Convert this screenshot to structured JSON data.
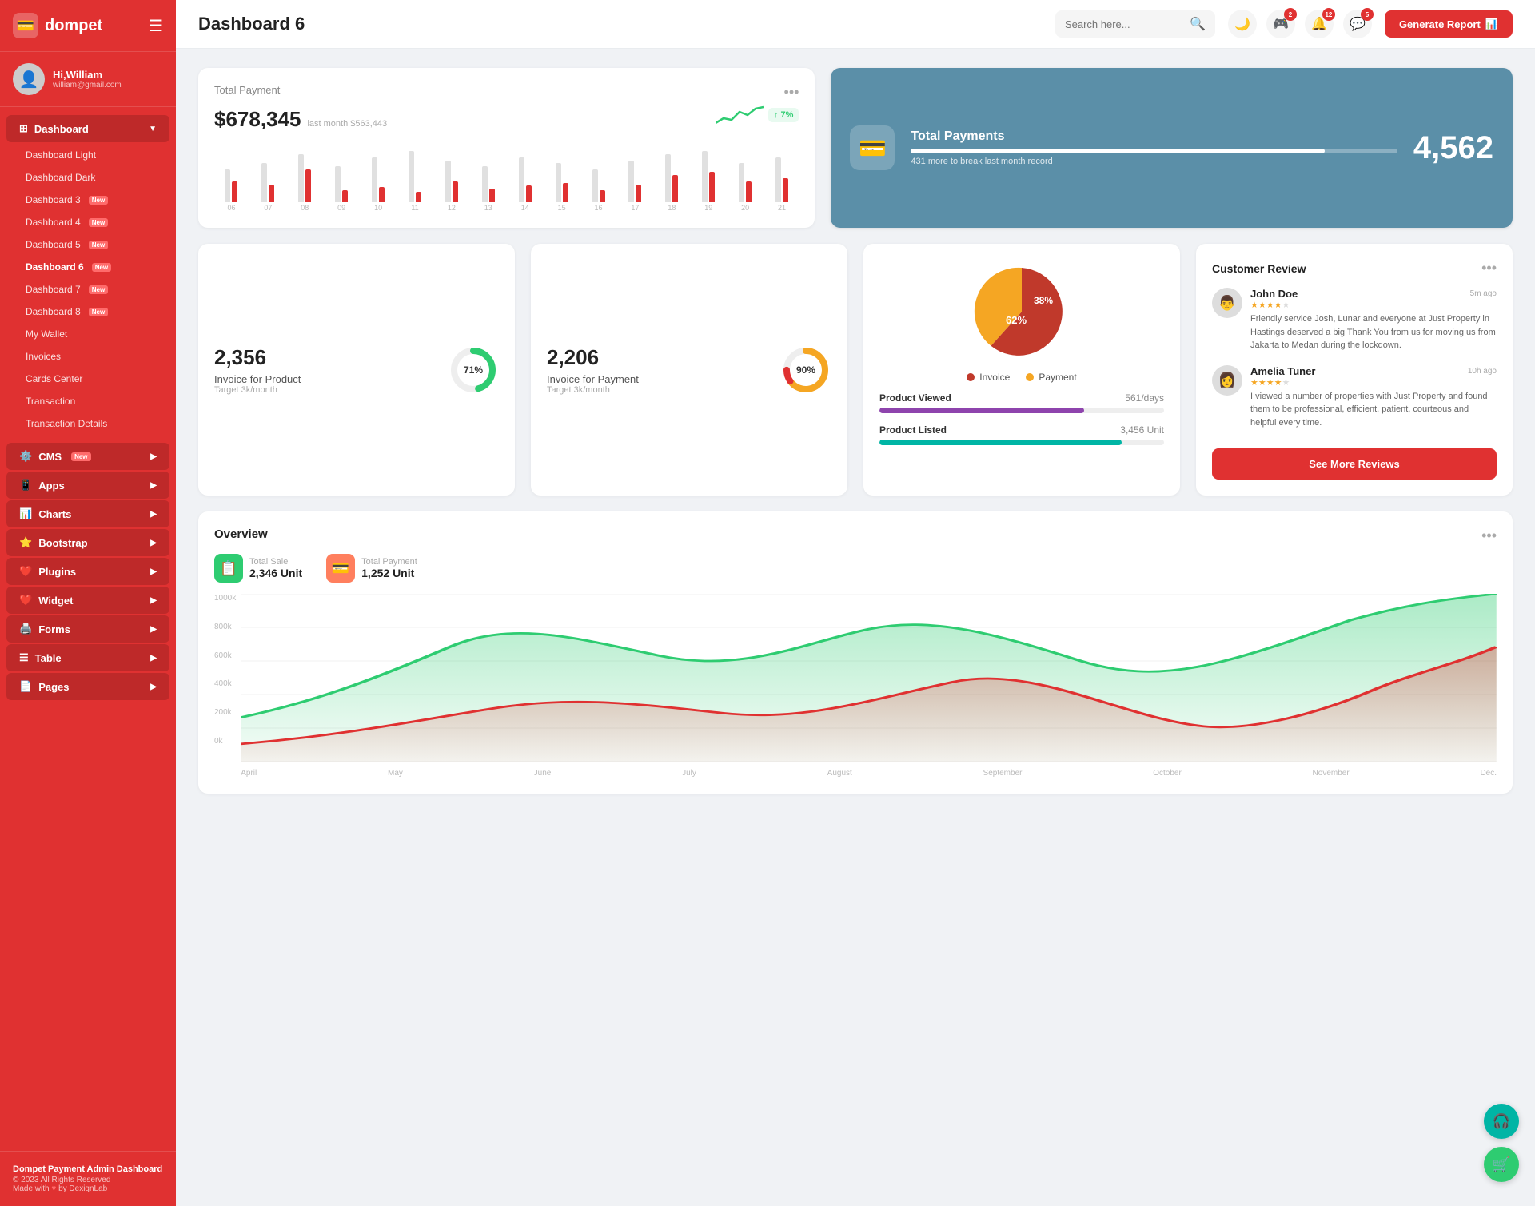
{
  "app": {
    "name": "dompet",
    "logo_symbol": "💳"
  },
  "user": {
    "greeting": "Hi,",
    "name": "William",
    "email": "william@gmail.com",
    "avatar_symbol": "👤"
  },
  "topbar": {
    "page_title": "Dashboard 6",
    "search_placeholder": "Search here...",
    "generate_report_label": "Generate Report",
    "icons": {
      "moon": "🌙",
      "game": "🎮",
      "bell": "🔔",
      "chat": "💬"
    },
    "badges": {
      "game": "2",
      "bell": "12",
      "chat": "5"
    }
  },
  "sidebar": {
    "dashboard_label": "Dashboard",
    "items": [
      {
        "id": "dashboard-light",
        "label": "Dashboard Light",
        "badge": ""
      },
      {
        "id": "dashboard-dark",
        "label": "Dashboard Dark",
        "badge": ""
      },
      {
        "id": "dashboard-3",
        "label": "Dashboard 3",
        "badge": "New"
      },
      {
        "id": "dashboard-4",
        "label": "Dashboard 4",
        "badge": "New"
      },
      {
        "id": "dashboard-5",
        "label": "Dashboard 5",
        "badge": "New"
      },
      {
        "id": "dashboard-6",
        "label": "Dashboard 6",
        "badge": "New",
        "active": true
      },
      {
        "id": "dashboard-7",
        "label": "Dashboard 7",
        "badge": "New"
      },
      {
        "id": "dashboard-8",
        "label": "Dashboard 8",
        "badge": "New"
      },
      {
        "id": "my-wallet",
        "label": "My Wallet",
        "badge": ""
      },
      {
        "id": "invoices",
        "label": "Invoices",
        "badge": ""
      },
      {
        "id": "cards-center",
        "label": "Cards Center",
        "badge": ""
      },
      {
        "id": "transaction",
        "label": "Transaction",
        "badge": ""
      },
      {
        "id": "transaction-details",
        "label": "Transaction Details",
        "badge": ""
      }
    ],
    "nav_sections": [
      {
        "id": "cms",
        "label": "CMS",
        "badge": "New",
        "icon": "⚙️"
      },
      {
        "id": "apps",
        "label": "Apps",
        "badge": "",
        "icon": "📱"
      },
      {
        "id": "charts",
        "label": "Charts",
        "badge": "",
        "icon": "📊"
      },
      {
        "id": "bootstrap",
        "label": "Bootstrap",
        "badge": "",
        "icon": "⭐"
      },
      {
        "id": "plugins",
        "label": "Plugins",
        "badge": "",
        "icon": "❤️"
      },
      {
        "id": "widget",
        "label": "Widget",
        "badge": "",
        "icon": "❤️"
      },
      {
        "id": "forms",
        "label": "Forms",
        "badge": "",
        "icon": "🖨️"
      },
      {
        "id": "table",
        "label": "Table",
        "badge": "",
        "icon": "☰"
      },
      {
        "id": "pages",
        "label": "Pages",
        "badge": "",
        "icon": "📄"
      }
    ],
    "footer": {
      "title": "Dompet Payment Admin Dashboard",
      "copyright": "© 2023 All Rights Reserved",
      "made_with": "Made with",
      "by": "by DexignLab"
    }
  },
  "total_payment": {
    "title": "Total Payment",
    "amount": "$678,345",
    "last_month_label": "last month $563,443",
    "trend_percent": "7%",
    "trend_arrow": "↑",
    "bars": [
      {
        "label": "06",
        "gray": 55,
        "red": 35
      },
      {
        "label": "07",
        "gray": 65,
        "red": 30
      },
      {
        "label": "08",
        "gray": 80,
        "red": 55
      },
      {
        "label": "09",
        "gray": 60,
        "red": 20
      },
      {
        "label": "10",
        "gray": 75,
        "red": 25
      },
      {
        "label": "11",
        "gray": 85,
        "red": 18
      },
      {
        "label": "12",
        "gray": 70,
        "red": 35
      },
      {
        "label": "13",
        "gray": 60,
        "red": 22
      },
      {
        "label": "14",
        "gray": 75,
        "red": 28
      },
      {
        "label": "15",
        "gray": 65,
        "red": 32
      },
      {
        "label": "16",
        "gray": 55,
        "red": 20
      },
      {
        "label": "17",
        "gray": 70,
        "red": 30
      },
      {
        "label": "18",
        "gray": 80,
        "red": 45
      },
      {
        "label": "19",
        "gray": 85,
        "red": 50
      },
      {
        "label": "20",
        "gray": 65,
        "red": 35
      },
      {
        "label": "21",
        "gray": 75,
        "red": 40
      }
    ]
  },
  "total_payments_blue": {
    "title": "Total Payments",
    "sub": "431 more to break last month record",
    "number": "4,562",
    "progress": 85,
    "icon": "💳"
  },
  "invoice_product": {
    "number": "2,356",
    "label": "Invoice for Product",
    "sub": "Target 3k/month",
    "percent": 71,
    "color": "#2ecc71"
  },
  "invoice_payment": {
    "number": "2,206",
    "label": "Invoice for Payment",
    "sub": "Target 3k/month",
    "percent": 90,
    "color": "#e03131"
  },
  "overview": {
    "title": "Overview",
    "total_sale_label": "Total Sale",
    "total_sale_value": "2,346 Unit",
    "total_payment_label": "Total Payment",
    "total_payment_value": "1,252 Unit",
    "months": [
      "April",
      "May",
      "June",
      "July",
      "August",
      "September",
      "October",
      "November",
      "Dec."
    ],
    "y_labels": [
      "1000k",
      "800k",
      "600k",
      "400k",
      "200k",
      "0k"
    ]
  },
  "pie_chart": {
    "invoice_pct": 62,
    "payment_pct": 38,
    "invoice_label": "Invoice",
    "payment_label": "Payment",
    "invoice_color": "#c0392b",
    "payment_color": "#f5a623"
  },
  "product_stats": {
    "product_viewed": {
      "label": "Product Viewed",
      "value": "561/days",
      "progress": 72,
      "color": "#8e44ad"
    },
    "product_listed": {
      "label": "Product Listed",
      "value": "3,456 Unit",
      "progress": 85,
      "color": "#00b5a5"
    }
  },
  "customer_review": {
    "title": "Customer Review",
    "reviews": [
      {
        "name": "John Doe",
        "stars": 4,
        "time": "5m ago",
        "text": "Friendly service Josh, Lunar and everyone at Just Property in Hastings deserved a big Thank You from us for moving us from Jakarta to Medan during the lockdown.",
        "avatar": "👨"
      },
      {
        "name": "Amelia Tuner",
        "stars": 4,
        "time": "10h ago",
        "text": "I viewed a number of properties with Just Property and found them to be professional, efficient, patient, courteous and helpful every time.",
        "avatar": "👩"
      }
    ],
    "see_more_label": "See More Reviews"
  },
  "floating_buttons": {
    "support_icon": "🎧",
    "cart_icon": "🛒"
  }
}
